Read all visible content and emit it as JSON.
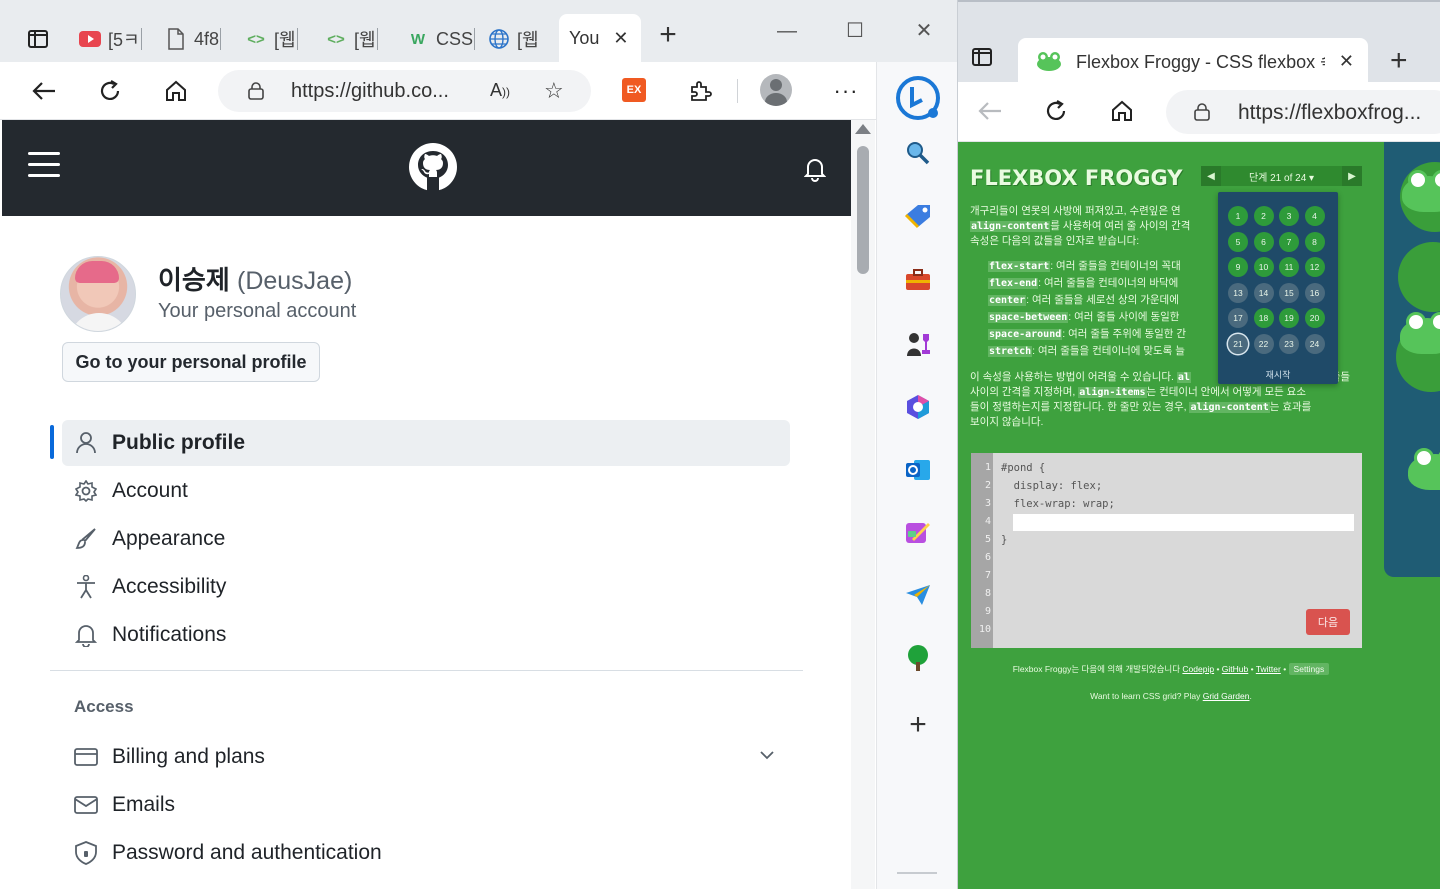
{
  "left_browser": {
    "tabs": [
      {
        "icon": "youtube-icon",
        "label": "[5ㅋ"
      },
      {
        "icon": "document-icon",
        "label": "4f8"
      },
      {
        "icon": "code-icon",
        "label": "[웹"
      },
      {
        "icon": "code-icon",
        "label": "[웹"
      },
      {
        "icon": "w3schools-icon",
        "label": "CSS"
      },
      {
        "icon": "globe-icon",
        "label": "[웹"
      }
    ],
    "active_tab": {
      "label": "You"
    },
    "url": "https://github.co...",
    "window_controls": {
      "minimize": "—",
      "maximize": "☐",
      "close": "✕"
    },
    "extension_badge": "EX"
  },
  "github": {
    "display_name": "이승제",
    "login": "(DeusJae)",
    "account_type": "Your personal account",
    "go_profile_button": "Go to your personal profile",
    "nav": [
      {
        "label": "Public profile",
        "icon": "person-icon",
        "active": true
      },
      {
        "label": "Account",
        "icon": "gear-icon"
      },
      {
        "label": "Appearance",
        "icon": "paintbrush-icon"
      },
      {
        "label": "Accessibility",
        "icon": "accessibility-icon"
      },
      {
        "label": "Notifications",
        "icon": "bell-icon"
      }
    ],
    "access_heading": "Access",
    "access_nav": [
      {
        "label": "Billing and plans",
        "icon": "credit-card-icon"
      },
      {
        "label": "Emails",
        "icon": "mail-icon"
      },
      {
        "label": "Password and authentication",
        "icon": "shield-lock-icon"
      }
    ]
  },
  "right_browser": {
    "active_tab": {
      "label": "Flexbox Froggy - CSS flexbox 속"
    },
    "url": "https://flexboxfrog..."
  },
  "froggy": {
    "logo": "FLEXBOX FROGGY",
    "level_label": "단계 21 of 24 ▾",
    "intro_line1": "개구리들이 연못의 사방에 퍼져있고, 수련잎은 연",
    "intro_tail1": "",
    "intro_code": "align-content",
    "intro_line2": "를 사용하여 여러 줄 사이의 간격",
    "intro_line3": "속성은 다음의 값들을 인자로 받습니다:",
    "values": [
      {
        "code": "flex-start",
        "text": ": 여러 줄들을 컨테이너의 꼭대"
      },
      {
        "code": "flex-end",
        "text": ": 여러 줄들을 컨테이너의 바닥에"
      },
      {
        "code": "center",
        "text": ": 여러 줄들을 세로선 상의 가운데에"
      },
      {
        "code": "space-between",
        "text": ": 여러 줄들 사이에 동일한"
      },
      {
        "code": "space-around",
        "text": ": 여러 줄들 주위에 동일한 간"
      },
      {
        "code": "stretch",
        "text": ": 여러 줄들을 컨테이너에 맞도록 늘"
      }
    ],
    "para2_a": "이 속성을 사용하는 방법이 어려울 수 있습니다. ",
    "para2_code1": "al",
    "para2_b": "사이의 간격을 지정하며, ",
    "para2_code2": "align-items",
    "para2_c": "는 컨테이너 안에서 어떻게 모든 요소",
    "para2_d": "들이 정렬하는지를 지정합니다. 한 줄만 있는 경우, ",
    "para2_code3": "align-content",
    "para2_e": "는 효과를",
    "para2_f": "보이지 않습니다.",
    "para2_right": "줄들",
    "popup": {
      "levels": [
        "1",
        "2",
        "3",
        "4",
        "5",
        "6",
        "7",
        "8",
        "9",
        "10",
        "11",
        "12",
        "13",
        "14",
        "15",
        "16",
        "17",
        "18",
        "19",
        "20",
        "21",
        "22",
        "23",
        "24"
      ],
      "completed": [
        1,
        2,
        3,
        4,
        5,
        6,
        7,
        8,
        9,
        10,
        11,
        12,
        18,
        19,
        20
      ],
      "current": 21,
      "reset": "재시작"
    },
    "editor": {
      "line_numbers": [
        "1",
        "2",
        "3",
        "4",
        "5",
        "6",
        "7",
        "8",
        "9",
        "10"
      ],
      "line1": "#pond {",
      "line2": "  display: flex;",
      "line3": "  flex-wrap: wrap;",
      "line5": "}",
      "next_button": "다음"
    },
    "footer1_text": "Flexbox Froggy는 다음에 의해 개발되었습니다 ",
    "footer1_links": [
      "Codepip",
      "GitHub",
      "Twitter"
    ],
    "footer1_settings": "Settings",
    "footer2_text": "Want to learn CSS grid? Play ",
    "footer2_link": "Grid Garden",
    "footer2_end": "."
  }
}
